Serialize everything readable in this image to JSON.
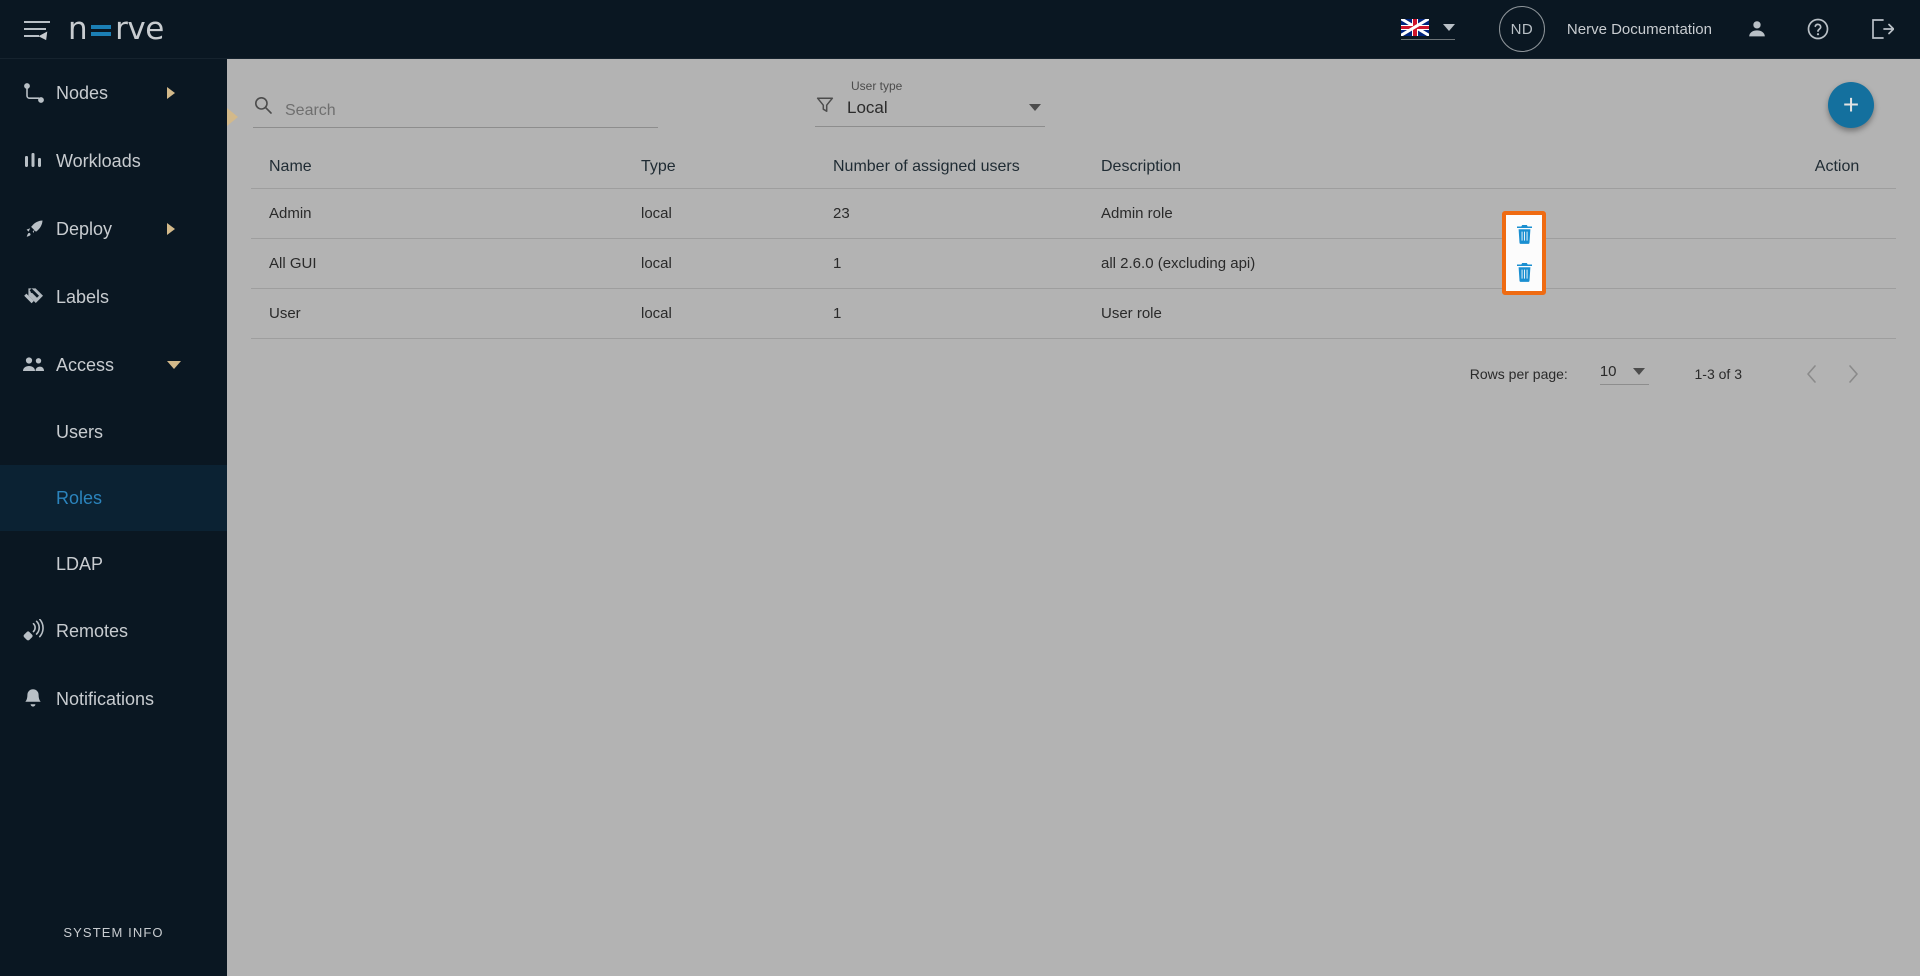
{
  "header": {
    "brand_n": "n",
    "brand_rve": "rve",
    "language": "en-GB",
    "avatar_initials": "ND",
    "user_name": "Nerve Documentation",
    "icons": {
      "menu": "hamburger-icon",
      "account": "person-icon",
      "help": "help-circle-icon",
      "logout": "logout-icon"
    }
  },
  "sidebar": {
    "items": [
      {
        "label": "Nodes",
        "icon": "nodes-icon",
        "expandable": "right"
      },
      {
        "label": "Workloads",
        "icon": "workloads-icon",
        "expandable": ""
      },
      {
        "label": "Deploy",
        "icon": "deploy-rocket-icon",
        "expandable": "right"
      },
      {
        "label": "Labels",
        "icon": "labels-tag-icon",
        "expandable": ""
      },
      {
        "label": "Access",
        "icon": "access-people-icon",
        "expandable": "down"
      }
    ],
    "subitems": [
      {
        "label": "Users",
        "active": false
      },
      {
        "label": "Roles",
        "active": true
      },
      {
        "label": "LDAP",
        "active": false
      }
    ],
    "items_after": [
      {
        "label": "Remotes",
        "icon": "remotes-icon",
        "expandable": ""
      },
      {
        "label": "Notifications",
        "icon": "bell-icon",
        "expandable": ""
      }
    ],
    "system_info": "SYSTEM INFO"
  },
  "toolbar": {
    "search_placeholder": "Search",
    "search_value": "",
    "filter_label": "User type",
    "filter_value": "Local",
    "add_label": "+"
  },
  "table": {
    "columns": [
      "Name",
      "Type",
      "Number of assigned users",
      "Description",
      "Action"
    ],
    "rows": [
      {
        "name": "Admin",
        "type": "local",
        "assigned": "23",
        "description": "Admin role",
        "has_delete": false
      },
      {
        "name": "All GUI",
        "type": "local",
        "assigned": "1",
        "description": "all 2.6.0 (excluding api)",
        "has_delete": true
      },
      {
        "name": "User",
        "type": "local",
        "assigned": "1",
        "description": "User role",
        "has_delete": true
      }
    ]
  },
  "pagination": {
    "rows_per_page_label": "Rows per page:",
    "rows_per_page_value": "10",
    "range_label": "1-3 of 3"
  },
  "colors": {
    "sidebar_bg": "#0a1722",
    "active_sub_bg": "#0b2233",
    "accent_blue": "#2b84bd",
    "brand_blue": "#1b7fb5",
    "fab_blue": "#14709e",
    "trash_blue": "#1a8fd1",
    "highlight_orange": "#ef6b12",
    "content_bg": "#b3b3b3"
  }
}
